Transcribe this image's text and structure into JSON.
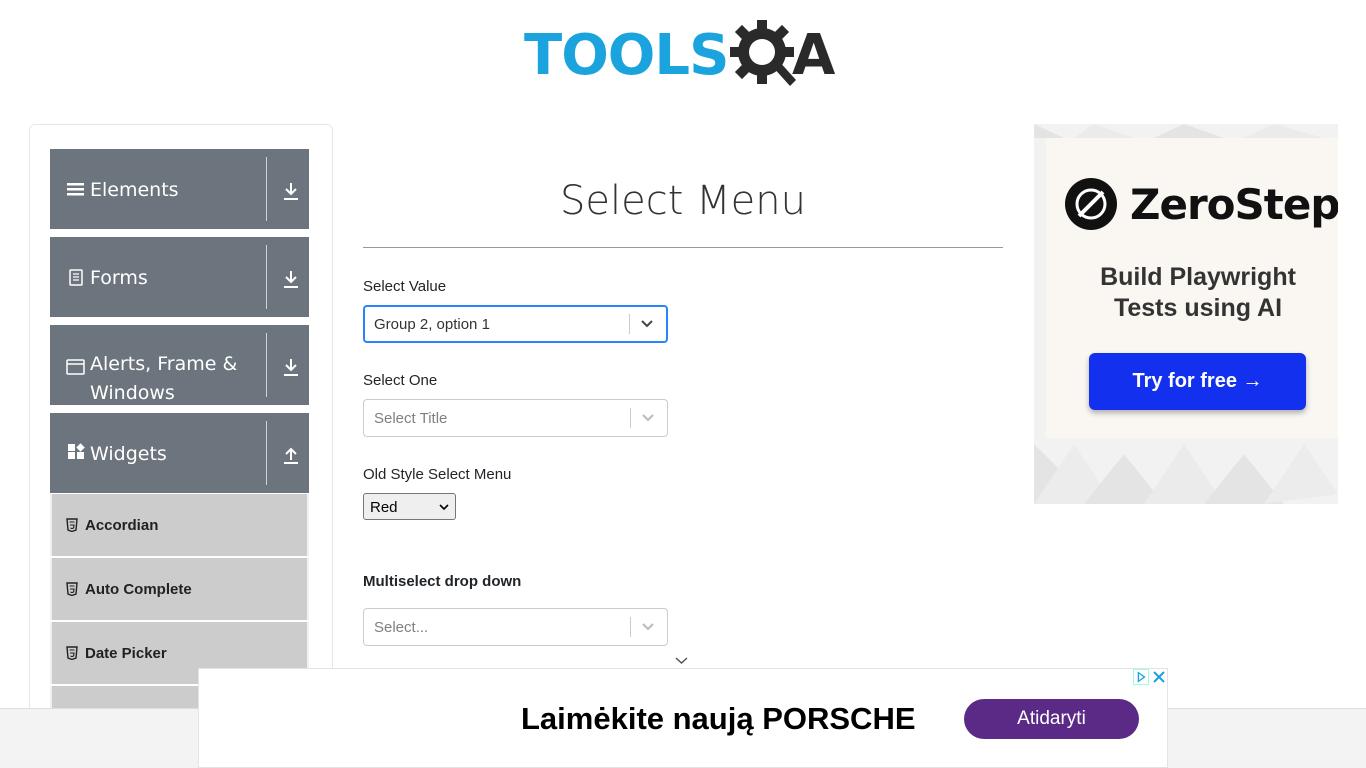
{
  "logo": {
    "tools": "TOOLS",
    "q_icon": "gear-magnifier-icon",
    "a": "A"
  },
  "sidebar": {
    "groups": [
      {
        "label": "Elements",
        "icon": "menu-icon",
        "arrow": "download-arrow-icon"
      },
      {
        "label": "Forms",
        "icon": "document-icon",
        "arrow": "download-arrow-icon"
      },
      {
        "label": "Alerts, Frame & Windows",
        "icon": "window-icon",
        "arrow": "download-arrow-icon"
      },
      {
        "label": "Widgets",
        "icon": "widgets-icon",
        "arrow": "upload-arrow-icon"
      }
    ],
    "items": [
      {
        "label": "Accordian",
        "icon": "html5-icon"
      },
      {
        "label": "Auto Complete",
        "icon": "html5-icon"
      },
      {
        "label": "Date Picker",
        "icon": "html5-icon"
      }
    ]
  },
  "main": {
    "title": "Select Menu",
    "select_value": {
      "label": "Select Value",
      "value": "Group 2, option 1"
    },
    "select_one": {
      "label": "Select One",
      "placeholder": "Select Title"
    },
    "old_style": {
      "label": "Old Style Select Menu",
      "value": "Red"
    },
    "multiselect": {
      "label": "Multiselect drop down",
      "placeholder": "Select..."
    }
  },
  "ad_right": {
    "brand": "ZeroStep",
    "tagline_line1": "Build Playwright",
    "tagline_line2": "Tests using AI",
    "button": "Try for free →"
  },
  "ad_bottom": {
    "headline": "Laimėkite naują PORSCHE",
    "button": "Atidaryti"
  },
  "colors": {
    "tools_blue": "#1aa3dd",
    "sidebar_group": "#6c757d",
    "sidebar_item": "#cccccc",
    "focus_border": "#2684ff",
    "zerostep_button": "#1230ee",
    "ad_button": "#5b2a86"
  }
}
